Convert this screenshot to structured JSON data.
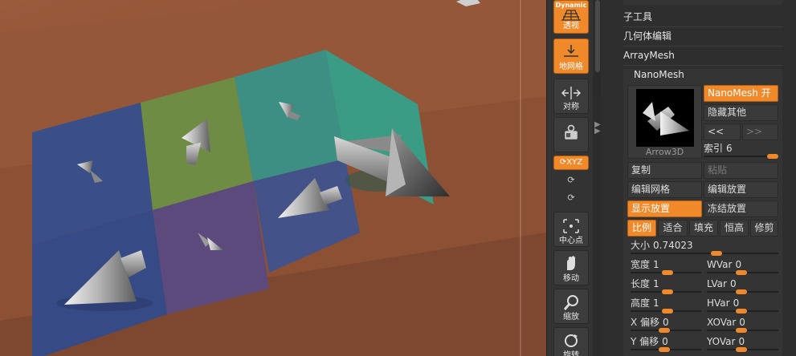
{
  "shelf": {
    "perspective": {
      "badge": "Dynamic",
      "label": "透视"
    },
    "floor_grid": {
      "label": "地网格"
    },
    "symmetry": {
      "label": "对称"
    },
    "xyz": {
      "label": "XYZ"
    },
    "center": {
      "label": "中心点"
    },
    "move": {
      "label": "移动"
    },
    "scale": {
      "label": "缩放"
    },
    "rotate": {
      "label": "旋转"
    }
  },
  "panel": {
    "subpalettes": [
      "子工具",
      "几何体编辑",
      "ArrayMesh"
    ],
    "nanomesh": {
      "title": "NanoMesh",
      "toggle_label": "NanoMesh 开",
      "hide_others": "隐藏其他",
      "prev": "<<",
      "next": ">>",
      "index_label": "索引",
      "index_value": "6",
      "thumb_label": "Arrow3D",
      "copy": "复制",
      "paste": "粘贴",
      "edit_mesh": "编辑网格",
      "edit_placement": "编辑放置",
      "show_placement": "显示放置",
      "freeze_placement": "冻结放置",
      "modes": [
        "比例",
        "适合",
        "填充",
        "恒高",
        "修剪"
      ],
      "size_label": "大小",
      "size_value": "0.74023",
      "sliders_left": [
        {
          "label": "宽度",
          "value": "1"
        },
        {
          "label": "长度",
          "value": "1"
        },
        {
          "label": "高度",
          "value": "1"
        },
        {
          "label": "X 偏移",
          "value": "0"
        },
        {
          "label": "Y 偏移",
          "value": "0"
        }
      ],
      "sliders_right": [
        {
          "label": "WVar",
          "value": "0"
        },
        {
          "label": "LVar",
          "value": "0"
        },
        {
          "label": "HVar",
          "value": "0"
        },
        {
          "label": "XOVar",
          "value": "0"
        },
        {
          "label": "YOVar",
          "value": "0"
        }
      ]
    }
  },
  "colors": {
    "accent": "#f0892a",
    "panel": "#2e2e2e",
    "surface": "#8a4f34"
  }
}
